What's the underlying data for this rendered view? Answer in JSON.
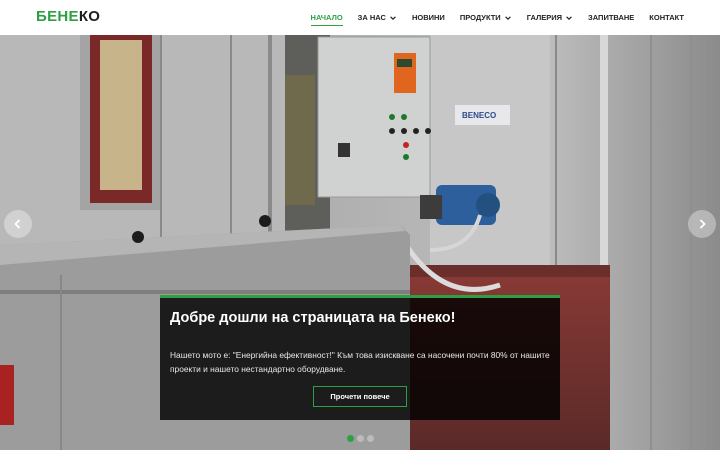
{
  "logo": {
    "part1": "БЕНЕ",
    "part2": "КО"
  },
  "nav": {
    "items": [
      {
        "label": "НАЧАЛО",
        "active": true,
        "dropdown": false
      },
      {
        "label": "ЗА НАС",
        "active": false,
        "dropdown": true
      },
      {
        "label": "НОВИНИ",
        "active": false,
        "dropdown": false
      },
      {
        "label": "ПРОДУКТИ",
        "active": false,
        "dropdown": true
      },
      {
        "label": "ГАЛЕРИЯ",
        "active": false,
        "dropdown": true
      },
      {
        "label": "ЗАПИТВАНЕ",
        "active": false,
        "dropdown": false
      },
      {
        "label": "КОНТАКТ",
        "active": false,
        "dropdown": false
      }
    ]
  },
  "hero": {
    "panel_label": "BENECO",
    "caption": {
      "title": "Добре дошли на страницата на Бенеко!",
      "text": "Нашето мото е: \"Енергийна ефективност!\" Към това изискване са насочени почти 80% от нашите проекти и нашето нестандартно оборудване.",
      "button_label": "Прочети повече"
    },
    "slides_count": 3,
    "active_slide": 1
  },
  "colors": {
    "accent": "#2ea043",
    "caption_bg": "rgba(0,0,0,0.82)"
  },
  "icons": {
    "prev": "chevron-left-icon",
    "next": "chevron-right-icon",
    "dropdown": "chevron-down-icon"
  }
}
